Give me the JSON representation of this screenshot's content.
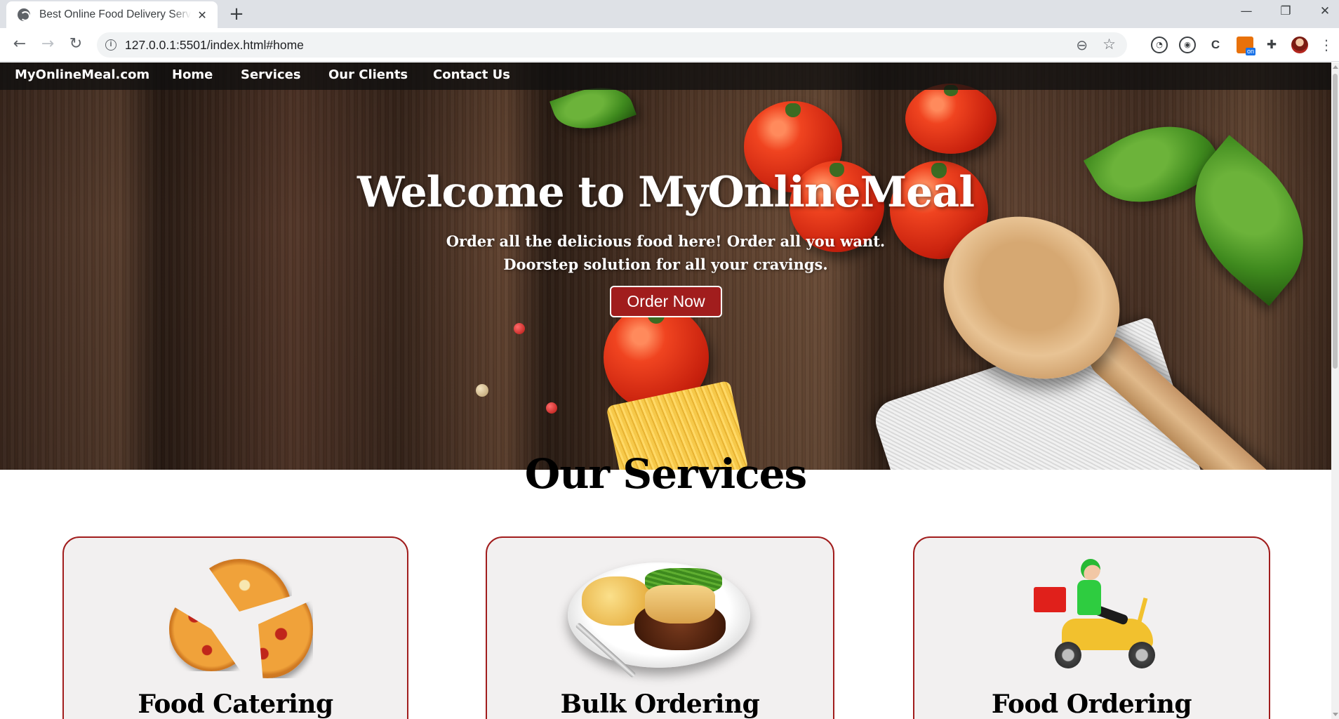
{
  "browser": {
    "tab_title": "Best Online Food Delivery Service",
    "tab_close": "✕",
    "new_tab": "+",
    "minimize": "—",
    "restore": "❐",
    "close": "✕",
    "url": "127.0.0.1:5501/index.html#home",
    "icons": {
      "back": "←",
      "forward": "→",
      "reload": "↻",
      "info": "i",
      "zoom": "⊖",
      "star": "☆",
      "extensions": [
        "dashboard-icon",
        "eye-icon",
        "c-icon",
        "orange-extension-icon",
        "puzzle-icon",
        "avatar",
        "menu-icon"
      ],
      "menu": "⋮"
    }
  },
  "nav": {
    "brand": "MyOnlineMeal.com",
    "links": [
      "Home",
      "Services",
      "Our Clients",
      "Contact Us"
    ]
  },
  "hero": {
    "title": "Welcome to MyOnlineMeal",
    "line1": "Order all the delicious food here! Order all you want.",
    "line2": "Doorstep solution for all your cravings.",
    "button": "Order Now"
  },
  "services": {
    "title": "Our Services",
    "cards": [
      {
        "title": "Food Catering",
        "image": "pizza-image"
      },
      {
        "title": "Bulk Ordering",
        "image": "meal-plate-image"
      },
      {
        "title": "Food Ordering",
        "image": "delivery-scooter-image"
      }
    ]
  },
  "colors": {
    "accent": "#a11d1d",
    "navbar": "#101010",
    "card_bg": "#f2f0f0"
  }
}
